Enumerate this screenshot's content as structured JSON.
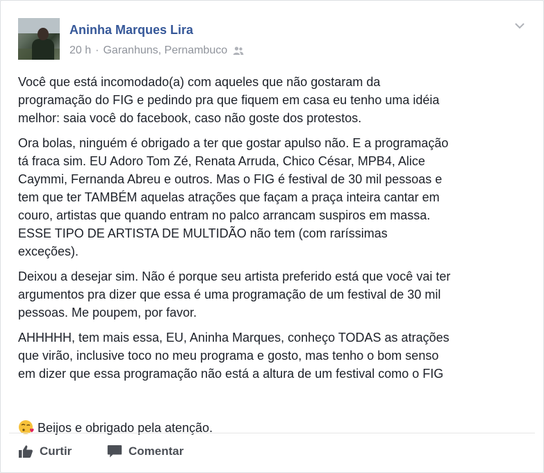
{
  "post": {
    "author": "Aninha Marques Lira",
    "time": "20 h",
    "separator": "·",
    "location": "Garanhuns, Pernambuco",
    "audience_icon": "friends-icon",
    "paragraphs": [
      "Você que está incomodado(a) com aqueles que não gostaram da\nprogramação do FIG e pedindo pra que fiquem em casa eu tenho uma idéia\nmelhor: saia você do facebook, caso não goste dos protestos.",
      "Ora bolas, ninguém é obrigado a ter que gostar apulso não. E a programação\ntá fraca sim. EU Adoro Tom Zé, Renata Arruda, Chico César, MPB4, Alice\nCaymmi, Fernanda Abreu e outros. Mas o FIG é festival de 30 mil pessoas e\ntem que ter TAMBÉM aquelas atrações que façam a praça inteira cantar em\ncouro, artistas que quando entram no palco arrancam suspiros em massa.\nESSE TIPO DE ARTISTA DE MULTIDÃO não tem (com raríssimas\nexceções).",
      "Deixou a desejar sim. Não é porque seu artista preferido está que você vai ter\nargumentos pra dizer que essa é uma programação de um festival de 30 mil\npessoas. Me poupem, por favor.",
      "AHHHHH, tem mais essa, EU, Aninha Marques, conheço TODAS as atrações\nque virão, inclusive toco no meu programa e gosto, mas tenho o bom senso\nem dizer que essa programação não está a altura de um festival como o FIG"
    ],
    "last_line": "Beijos e obrigado pela atenção.",
    "emoji_icon": "kiss-emoji-icon"
  },
  "actions": {
    "like_label": "Curtir",
    "comment_label": "Comentar"
  },
  "colors": {
    "author_link": "#365899",
    "meta": "#90949c",
    "text": "#1d2129",
    "action": "#4b4f56"
  }
}
